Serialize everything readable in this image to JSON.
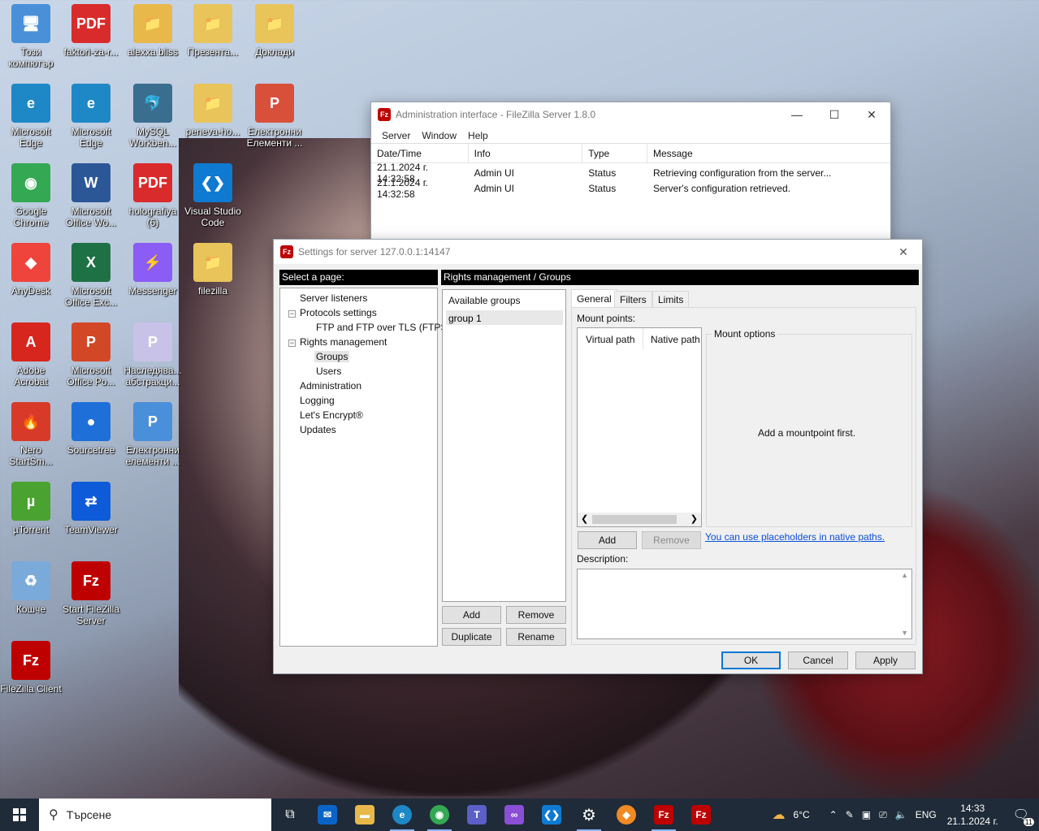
{
  "desktop_icons": [
    {
      "label": "Този компютър",
      "color": "#4a90d9",
      "glyph": "🖥"
    },
    {
      "label": "faktori-za-r...",
      "color": "#d92b2b",
      "glyph": "PDF"
    },
    {
      "label": "alexxa bliss",
      "color": "#e8b84a",
      "glyph": "📁"
    },
    {
      "label": "Презента...",
      "color": "#e8c45a",
      "glyph": "📁"
    },
    {
      "label": "Доклади",
      "color": "#e8c45a",
      "glyph": "📁"
    },
    {
      "label": "Microsoft Edge",
      "color": "#1e88c7",
      "glyph": "e"
    },
    {
      "label": "Microsoft Edge",
      "color": "#1e88c7",
      "glyph": "e"
    },
    {
      "label": "MySQL Workben...",
      "color": "#3a6e8f",
      "glyph": "🐬"
    },
    {
      "label": "peneva-ho...",
      "color": "#e8c45a",
      "glyph": "📁"
    },
    {
      "label": "Електронни Елементи ...",
      "color": "#d8503a",
      "glyph": "P"
    },
    {
      "label": "Google Chrome",
      "color": "#34a853",
      "glyph": "◉"
    },
    {
      "label": "Microsoft Office Wo...",
      "color": "#2b5797",
      "glyph": "W"
    },
    {
      "label": "holografiya (6)",
      "color": "#d92b2b",
      "glyph": "PDF"
    },
    {
      "label": "Visual Studio Code",
      "color": "#0e7ad1",
      "glyph": "❮❯"
    },
    {
      "label": "AnyDesk",
      "color": "#ef443b",
      "glyph": "◆"
    },
    {
      "label": "Microsoft Office Exc...",
      "color": "#1e7145",
      "glyph": "X"
    },
    {
      "label": "Messenger",
      "color": "#8b5cf6",
      "glyph": "⚡"
    },
    {
      "label": "filezilla",
      "color": "#e8c45a",
      "glyph": "📁"
    },
    {
      "label": "Adobe Acrobat",
      "color": "#d7261e",
      "glyph": "A"
    },
    {
      "label": "Microsoft Office Po...",
      "color": "#d24726",
      "glyph": "P"
    },
    {
      "label": "Наследява... абстракци...",
      "color": "#c9c2e8",
      "glyph": "P"
    },
    {
      "label": "Nero StartSm...",
      "color": "#d83a2a",
      "glyph": "🔥"
    },
    {
      "label": "Sourcetree",
      "color": "#1f6fd9",
      "glyph": "●"
    },
    {
      "label": "Електронни елементи ...",
      "color": "#4a8fd9",
      "glyph": "P"
    },
    {
      "label": "µTorrent",
      "color": "#4aa331",
      "glyph": "µ"
    },
    {
      "label": "TeamViewer",
      "color": "#0e5bd9",
      "glyph": "⇄"
    },
    {
      "label": "Кошче",
      "color": "#7aaad9",
      "glyph": "♻"
    },
    {
      "label": "Start FileZilla Server",
      "color": "#bf0000",
      "glyph": "Fz"
    },
    {
      "label": "FileZilla Client",
      "color": "#bf0000",
      "glyph": "Fz"
    }
  ],
  "admin_window": {
    "title": "Administration interface - FileZilla Server 1.8.0",
    "menu": [
      "Server",
      "Window",
      "Help"
    ],
    "columns": [
      "Date/Time",
      "Info",
      "Type",
      "Message"
    ],
    "rows": [
      [
        "21.1.2024 г. 14:32:58",
        "Admin UI",
        "Status",
        "Retrieving configuration from the server..."
      ],
      [
        "21.1.2024 г. 14:32:58",
        "Admin UI",
        "Status",
        "Server's configuration retrieved."
      ]
    ]
  },
  "settings": {
    "title": "Settings for server 127.0.0.1:14147",
    "select_page": "Select a page:",
    "page_header": "Rights management / Groups",
    "tree": {
      "server_listeners": "Server listeners",
      "protocols_settings": "Protocols settings",
      "ftp_tls": "FTP and FTP over TLS (FTPS)",
      "rights_management": "Rights management",
      "groups": "Groups",
      "users": "Users",
      "administration": "Administration",
      "logging": "Logging",
      "lets_encrypt": "Let's Encrypt®",
      "updates": "Updates"
    },
    "available_groups": "Available groups",
    "groups": [
      "group 1"
    ],
    "group_buttons": {
      "add": "Add",
      "remove": "Remove",
      "duplicate": "Duplicate",
      "rename": "Rename"
    },
    "tabs": [
      "General",
      "Filters",
      "Limits"
    ],
    "mount_points_label": "Mount points:",
    "mount_columns": [
      "Virtual path",
      "Native path"
    ],
    "mount_options_label": "Mount options",
    "mount_empty": "Add a mountpoint first.",
    "mount_add": "Add",
    "mount_remove": "Remove",
    "placeholders_link": "You can use placeholders in native paths.",
    "description_label": "Description:",
    "ok": "OK",
    "cancel": "Cancel",
    "apply": "Apply"
  },
  "taskbar": {
    "search_placeholder": "Търсене",
    "weather": "6°C",
    "language": "ENG",
    "time": "14:33",
    "date": "21.1.2024 г.",
    "notifications": "11"
  }
}
